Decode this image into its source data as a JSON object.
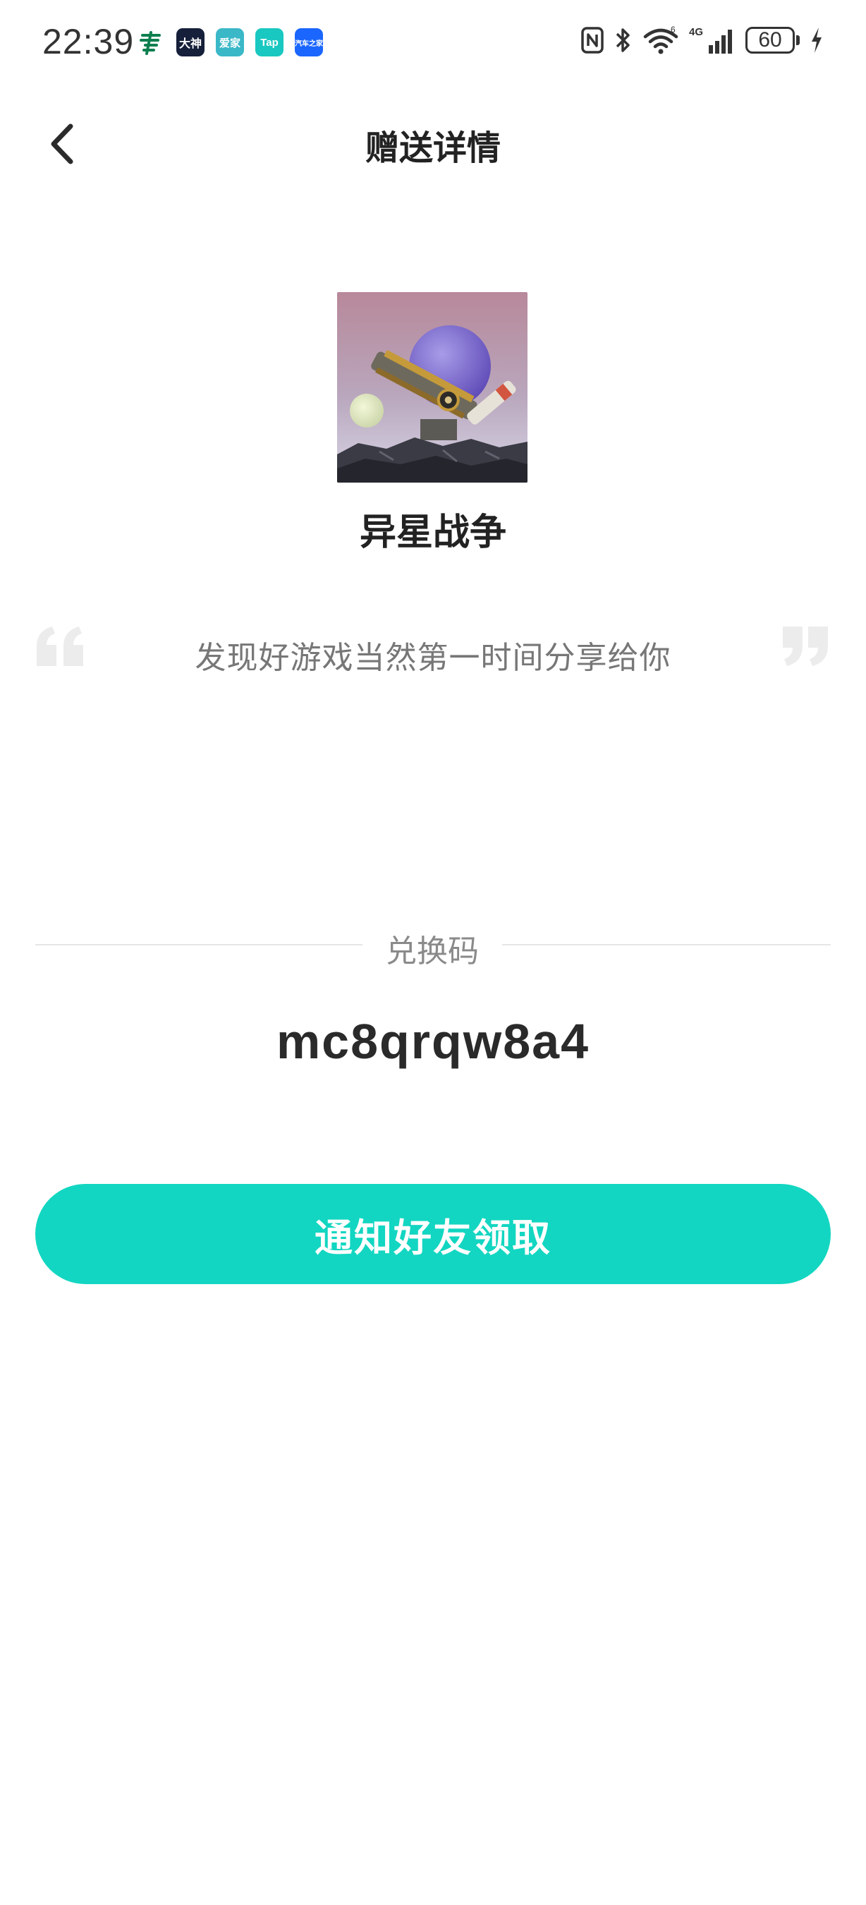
{
  "status_bar": {
    "time": "22:39",
    "notification_icons": [
      {
        "name": "china-post-icon",
        "glyph": "邮",
        "style": "post"
      },
      {
        "name": "dashen-app-icon",
        "glyph": "大神",
        "style": "dashen"
      },
      {
        "name": "aijia-app-icon",
        "glyph": "爱家",
        "style": "aijia"
      },
      {
        "name": "tap-app-icon",
        "glyph": "Tap",
        "style": "tap"
      },
      {
        "name": "autohome-app-icon",
        "glyph": "汽车之家",
        "style": "qiche"
      }
    ],
    "network_label": "4G",
    "wifi_label": "6",
    "battery_level": "60"
  },
  "nav": {
    "title": "赠送详情"
  },
  "game": {
    "name": "异星战争"
  },
  "message": {
    "text": "发现好游戏当然第一时间分享给你"
  },
  "redeem": {
    "label": "兑换码",
    "code": "mc8qrqw8a4"
  },
  "actions": {
    "notify_label": "通知好友领取"
  },
  "colors": {
    "accent": "#12d6c1",
    "title_text": "#222222",
    "secondary_text": "#777777",
    "divider": "#e6e6e6"
  }
}
